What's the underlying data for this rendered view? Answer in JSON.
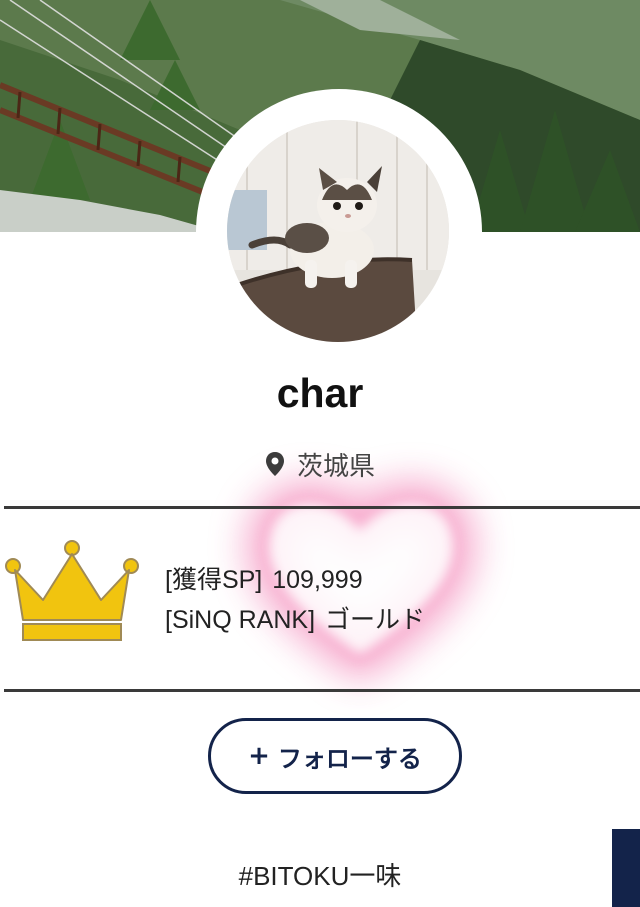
{
  "profile": {
    "name": "char",
    "location": "茨城県"
  },
  "stats": {
    "sp_label": "[獲得SP]",
    "sp_value": "109,999",
    "rank_label": "[SiNQ RANK]",
    "rank_value": "ゴールド"
  },
  "follow": {
    "label": "フォローする",
    "plus": "+"
  },
  "hashtag": "#BITOKU一味",
  "icons": {
    "location": "map-pin-icon",
    "rank": "crown-icon",
    "follow": "plus-icon"
  },
  "colors": {
    "accent": "#13234a",
    "crown": "#f1c40f",
    "rule": "#3a3a3a"
  }
}
